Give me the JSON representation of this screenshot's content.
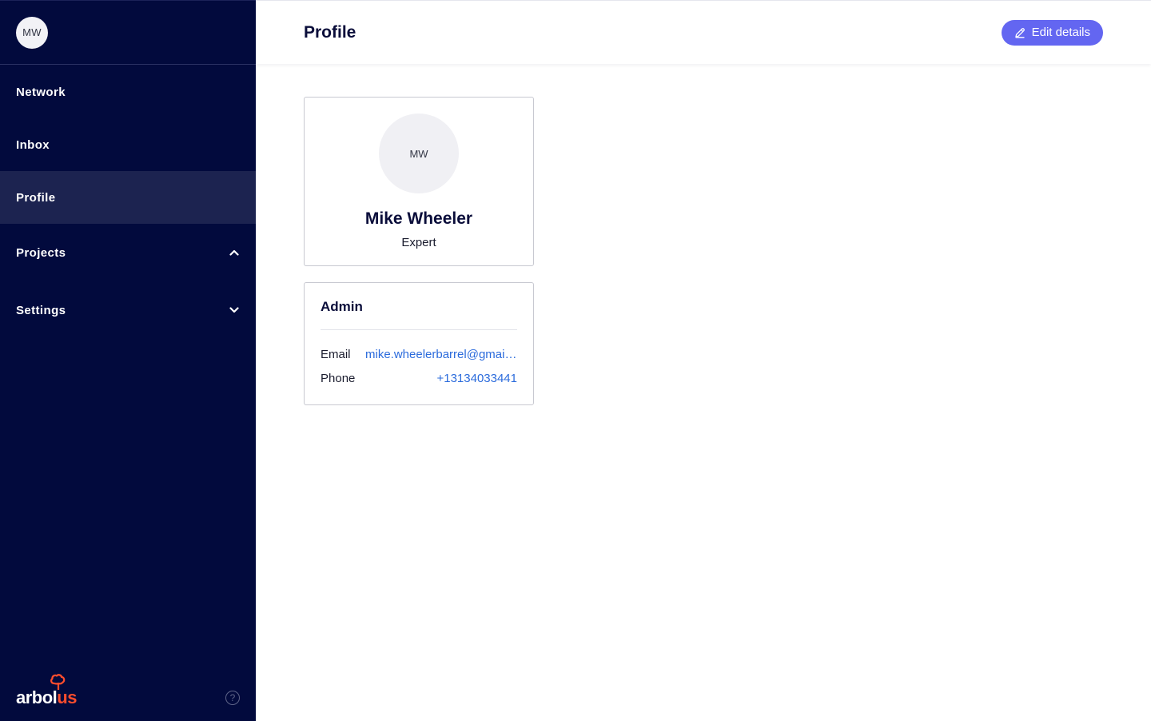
{
  "sidebar": {
    "avatar_initials": "MW",
    "items": [
      {
        "label": "Network"
      },
      {
        "label": "Inbox"
      },
      {
        "label": "Profile",
        "active": true
      },
      {
        "label": "Projects",
        "expanded": true
      },
      {
        "label": "Settings",
        "expanded": false
      }
    ],
    "logo": {
      "part1": "arbol",
      "part2": "us"
    },
    "help_symbol": "?"
  },
  "header": {
    "title": "Profile",
    "edit_button_label": "Edit details"
  },
  "profile_card": {
    "initials": "MW",
    "name": "Mike Wheeler",
    "role": "Expert"
  },
  "admin_card": {
    "title": "Admin",
    "email_label": "Email",
    "email_value": "mike.wheelerbarrel@gmail.com",
    "phone_label": "Phone",
    "phone_value": "+13134033441"
  },
  "colors": {
    "sidebar_bg": "#020a3d",
    "sidebar_active": "#1c2350",
    "accent": "#6366f1",
    "link": "#2b6bdc",
    "logo_orange": "#ff4d2d"
  },
  "icons": {
    "edit": "pencil-icon",
    "projects_chevron": "chevron-up-icon",
    "settings_chevron": "chevron-down-icon",
    "help": "help-circle-icon"
  }
}
